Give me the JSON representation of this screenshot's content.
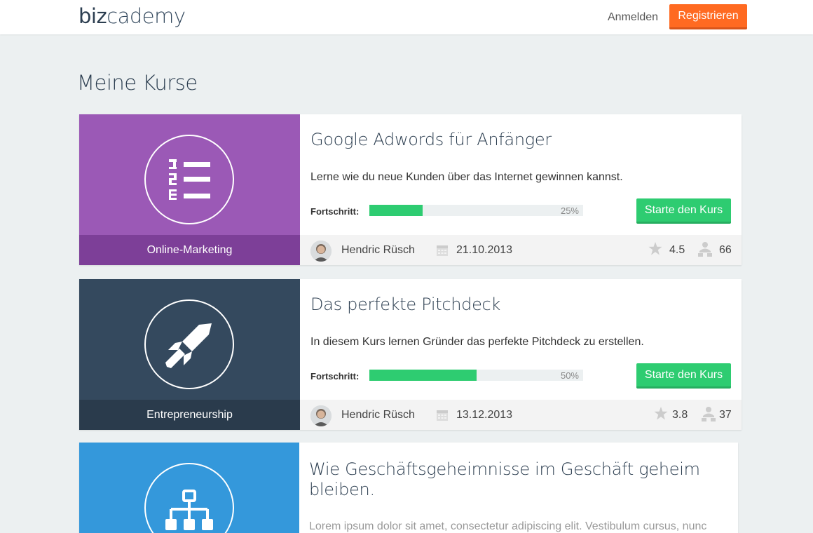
{
  "header": {
    "logo_biz": "biz",
    "logo_cademy": "cademy",
    "login_label": "Anmelden",
    "register_label": "Registrieren"
  },
  "page": {
    "title": "Meine Kurse"
  },
  "colors": {
    "accent_orange": "#ff6a21",
    "progress_green": "#2ecc71",
    "purple": "#9b59b6",
    "navy": "#34495e",
    "blue": "#3498db"
  },
  "courses": [
    {
      "title": "Google Adwords für Anfänger",
      "description": "Lerne wie du neue Kunden über das Internet gewinnen kannst.",
      "category": "Online-Marketing",
      "icon": "numbered-list-icon",
      "progress_label": "Fortschritt:",
      "progress_pct": "25%",
      "progress_value": 25,
      "start_label": "Starte den Kurs",
      "author": "Hendric Rüsch",
      "date": "21.10.2013",
      "rating": "4.5",
      "students": "66"
    },
    {
      "title": "Das perfekte Pitchdeck",
      "description": "In diesem Kurs lernen Gründer das perfekte Pitchdeck zu erstellen.",
      "category": "Entrepreneurship",
      "icon": "rocket-icon",
      "progress_label": "Fortschritt:",
      "progress_pct": "50%",
      "progress_value": 50,
      "start_label": "Starte den Kurs",
      "author": "Hendric Rüsch",
      "date": "13.12.2013",
      "rating": "3.8",
      "students": "37"
    },
    {
      "title": "Wie Geschäftsgeheimnisse im Geschäft geheim bleiben.",
      "description": "Lorem ipsum dolor sit amet, consectetur adipiscing elit. Vestibulum cursus, nunc",
      "icon": "org-chart-icon"
    }
  ]
}
